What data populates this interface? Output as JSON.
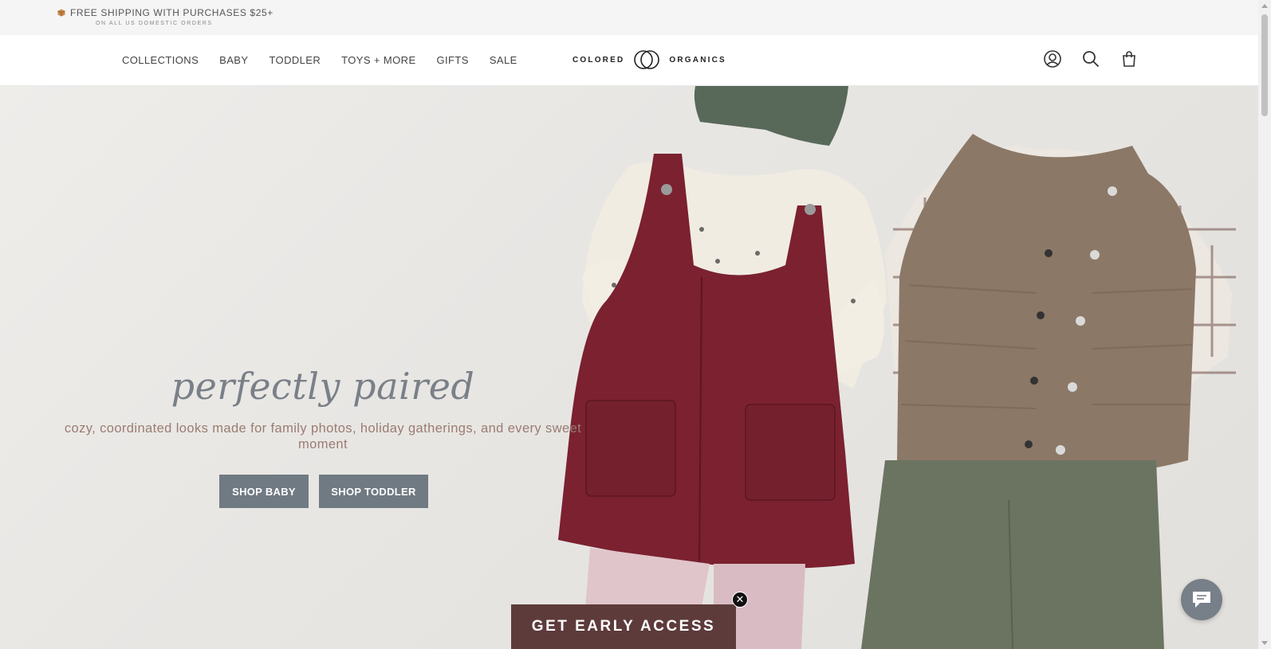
{
  "announcement": {
    "line1": "FREE SHIPPING WITH PURCHASES $25+",
    "line2": "ON ALL US DOMESTIC ORDERS",
    "icon": "box-icon"
  },
  "nav": {
    "items": [
      {
        "label": "COLLECTIONS"
      },
      {
        "label": "BABY"
      },
      {
        "label": "TODDLER"
      },
      {
        "label": "TOYS + MORE"
      },
      {
        "label": "GIFTS"
      },
      {
        "label": "SALE"
      }
    ]
  },
  "logo": {
    "left": "COLORED",
    "right": "ORGANICS"
  },
  "header_icons": [
    "account-icon",
    "search-icon",
    "bag-icon"
  ],
  "hero": {
    "title": "perfectly paired",
    "subtitle": "cozy, coordinated looks made for family photos, holiday gatherings, and every sweet moment",
    "buttons": {
      "baby": "SHOP BABY",
      "toddler": "SHOP TODDLER"
    }
  },
  "popup": {
    "label": "GET EARLY ACCESS",
    "close": "✕"
  },
  "colors": {
    "button": "#707a83",
    "popup": "#5e3b3b",
    "title": "#7a8088",
    "subtitle": "#9a7c72"
  }
}
